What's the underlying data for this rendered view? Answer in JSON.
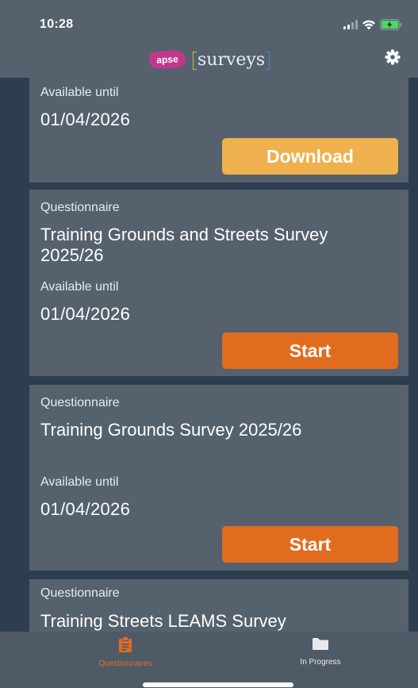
{
  "status_bar": {
    "time": "10:28",
    "icons": [
      "signal-icon",
      "wifi-icon",
      "battery-charging-icon"
    ]
  },
  "header": {
    "logo_badge": "apse",
    "logo_word": "surveys",
    "settings_icon": "gear-icon"
  },
  "colors": {
    "background": "#56616e",
    "list_background": "#2c3e50",
    "download_button": "#eeb14d",
    "start_button": "#e26c1e",
    "active_tab": "#e26c1e",
    "inactive_tab": "#e8ebee"
  },
  "cards": [
    {
      "label": "Available until",
      "date": "01/04/2026",
      "button": "Download"
    },
    {
      "kicker": "Questionnaire",
      "title": "Training Grounds and Streets Survey 2025/26",
      "label": "Available until",
      "date": "01/04/2026",
      "button": "Start"
    },
    {
      "kicker": "Questionnaire",
      "title": "Training Grounds Survey 2025/26",
      "label": "Available until",
      "date": "01/04/2026",
      "button": "Start"
    },
    {
      "kicker": "Questionnaire",
      "title": "Training Streets LEAMS Survey"
    }
  ],
  "tabs": [
    {
      "label": "Questionnaires",
      "icon": "clipboard-icon",
      "active": true
    },
    {
      "label": "In Progress",
      "icon": "folder-icon",
      "active": false
    }
  ]
}
